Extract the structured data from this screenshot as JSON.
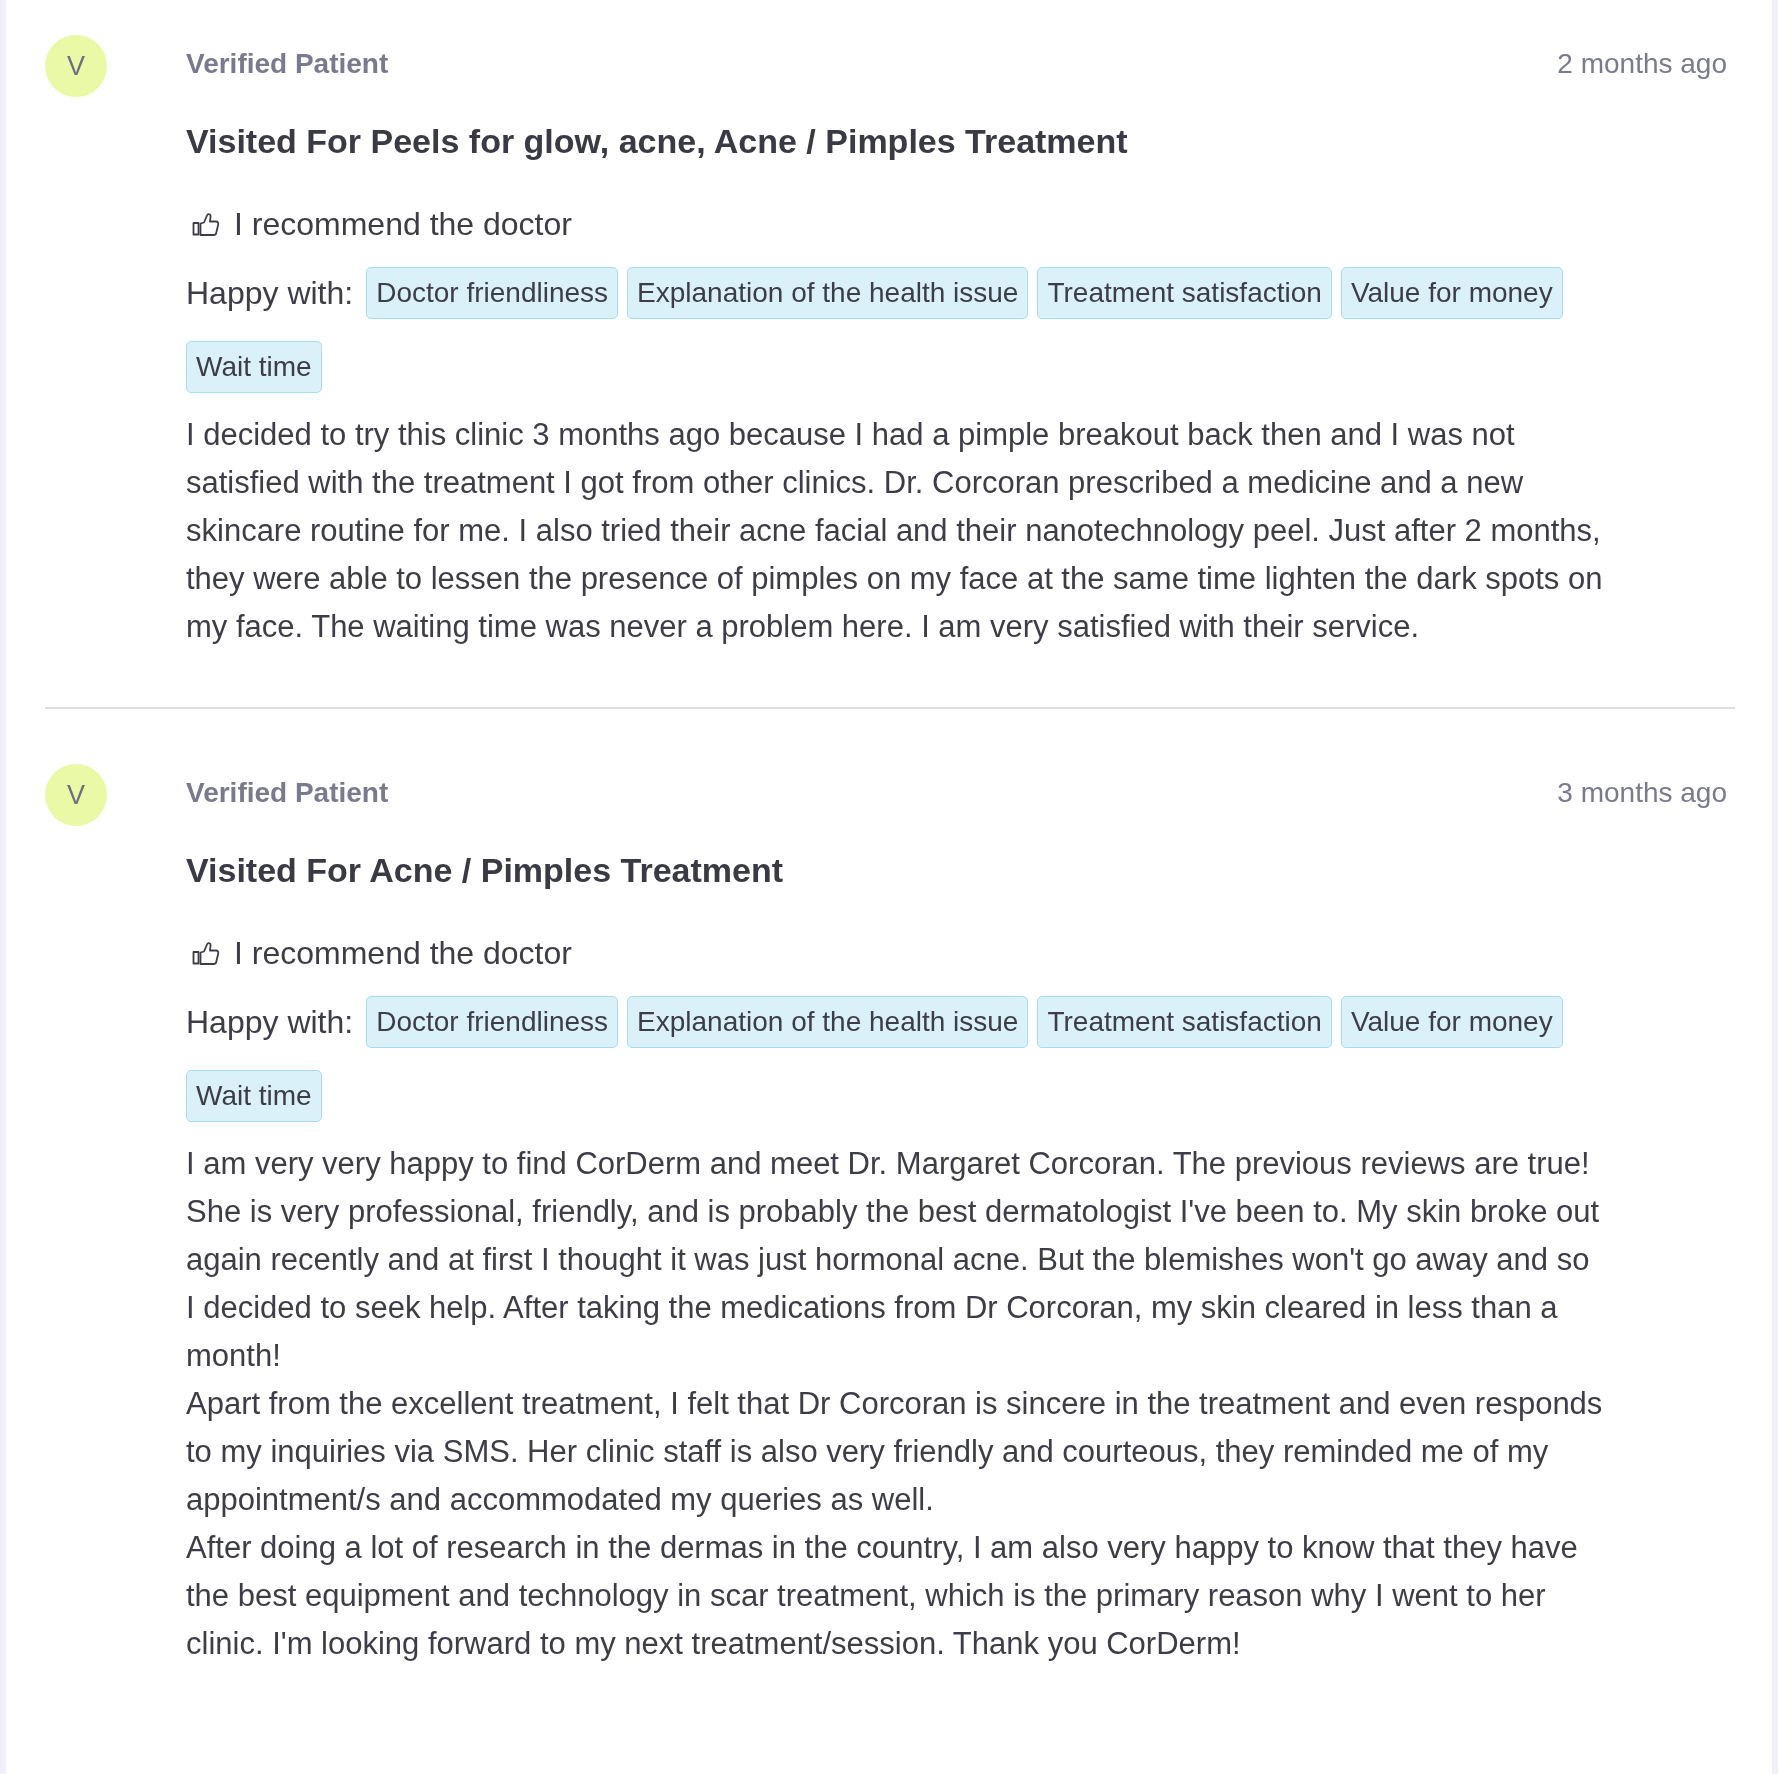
{
  "reviews": [
    {
      "avatar_letter": "V",
      "author": "Verified Patient",
      "time": "2 months ago",
      "title": "Visited For Peels for glow, acne, Acne / Pimples Treatment",
      "recommendation": "I recommend the doctor",
      "happy_with_label": "Happy with:",
      "tags": [
        "Doctor friendliness",
        "Explanation of the health issue",
        "Treatment satisfaction",
        "Value for money",
        "Wait time"
      ],
      "body": [
        "I decided to try this clinic 3 months ago because I had a pimple breakout back then and I was not satisfied with the treatment I got from other clinics. Dr. Corcoran prescribed a medicine and a new skincare routine for me. I also tried their acne facial and their nanotechnology peel. Just after 2 months, they were able to lessen the presence of pimples on my face at the same time lighten the dark spots on my face. The waiting time was never a problem here. I am very satisfied with their service."
      ]
    },
    {
      "avatar_letter": "V",
      "author": "Verified Patient",
      "time": "3 months ago",
      "title": "Visited For Acne / Pimples Treatment",
      "recommendation": "I recommend the doctor",
      "happy_with_label": "Happy with:",
      "tags": [
        "Doctor friendliness",
        "Explanation of the health issue",
        "Treatment satisfaction",
        "Value for money",
        "Wait time"
      ],
      "body": [
        "I am very very happy to find CorDerm and meet Dr. Margaret Corcoran. The previous reviews are true! She is very professional, friendly, and is probably the best dermatologist I've been to. My skin broke out again recently and at first I thought it was just hormonal acne. But the blemishes won't go away and so I decided to seek help. After taking the medications from Dr Corcoran, my skin cleared in less than a month!",
        "Apart from the excellent treatment, I felt that Dr Corcoran is sincere in the treatment and even responds to my inquiries via SMS. Her clinic staff is also very friendly and courteous, they reminded me of my appointment/s and accommodated my queries as well.",
        "After doing a lot of research in the dermas in the country, I am also very happy to know that they have the best equipment and technology in scar treatment, which is the primary reason why I went to her clinic. I'm looking forward to my next treatment/session. Thank you CorDerm!"
      ]
    }
  ]
}
